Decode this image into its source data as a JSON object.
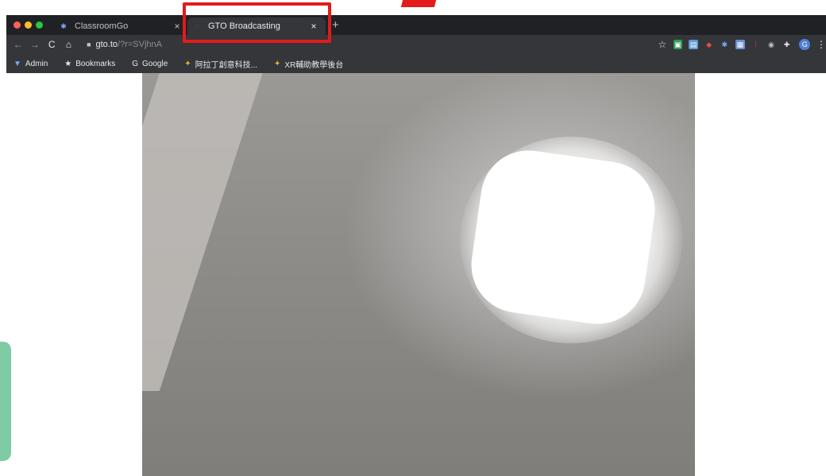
{
  "browser": {
    "tabs": [
      {
        "title": "ClassroomGo",
        "favicon": "classroomgo-icon",
        "close": "×"
      },
      {
        "title": "GTO Broadcasting",
        "favicon": "globe-icon",
        "close": "×"
      }
    ],
    "new_tab": "+",
    "url_host": "gto.to",
    "url_path": "/?r=SVjhnA",
    "bookmarks": [
      {
        "label": "Admin",
        "icon": "admin-icon"
      },
      {
        "label": "Bookmarks",
        "icon": "star-icon"
      },
      {
        "label": "Google",
        "icon": "google-icon"
      },
      {
        "label": "阿拉丁創意科技...",
        "icon": "aladdin-icon"
      },
      {
        "label": "XR輔助教學後台",
        "icon": "xr-icon"
      }
    ],
    "profile_initial": "G"
  },
  "colors": {
    "highlight_box": "#e01b1b",
    "chrome_dark": "#202124",
    "chrome_toolbar": "#35363a"
  }
}
